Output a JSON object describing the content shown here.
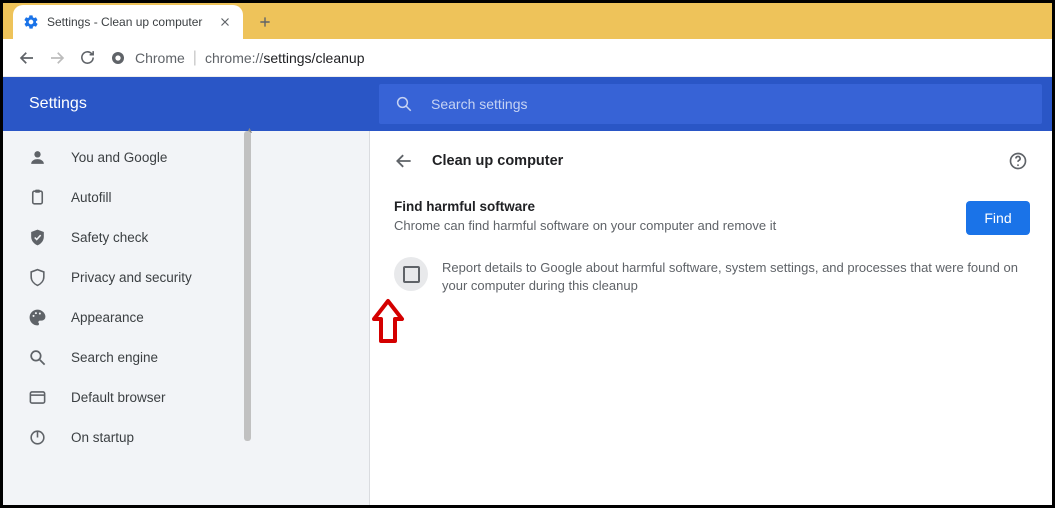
{
  "tab": {
    "title": "Settings - Clean up computer"
  },
  "omnibox": {
    "host": "Chrome",
    "path_dim": "chrome://",
    "path_bold": "settings/cleanup"
  },
  "header": {
    "title": "Settings",
    "search_placeholder": "Search settings"
  },
  "sidebar": {
    "items": [
      {
        "label": "You and Google"
      },
      {
        "label": "Autofill"
      },
      {
        "label": "Safety check"
      },
      {
        "label": "Privacy and security"
      },
      {
        "label": "Appearance"
      },
      {
        "label": "Search engine"
      },
      {
        "label": "Default browser"
      },
      {
        "label": "On startup"
      }
    ]
  },
  "page": {
    "title": "Clean up computer",
    "find_title": "Find harmful software",
    "find_desc": "Chrome can find harmful software on your computer and remove it",
    "find_button": "Find",
    "report_desc": "Report details to Google about harmful software, system settings, and processes that were found on your computer during this cleanup"
  }
}
